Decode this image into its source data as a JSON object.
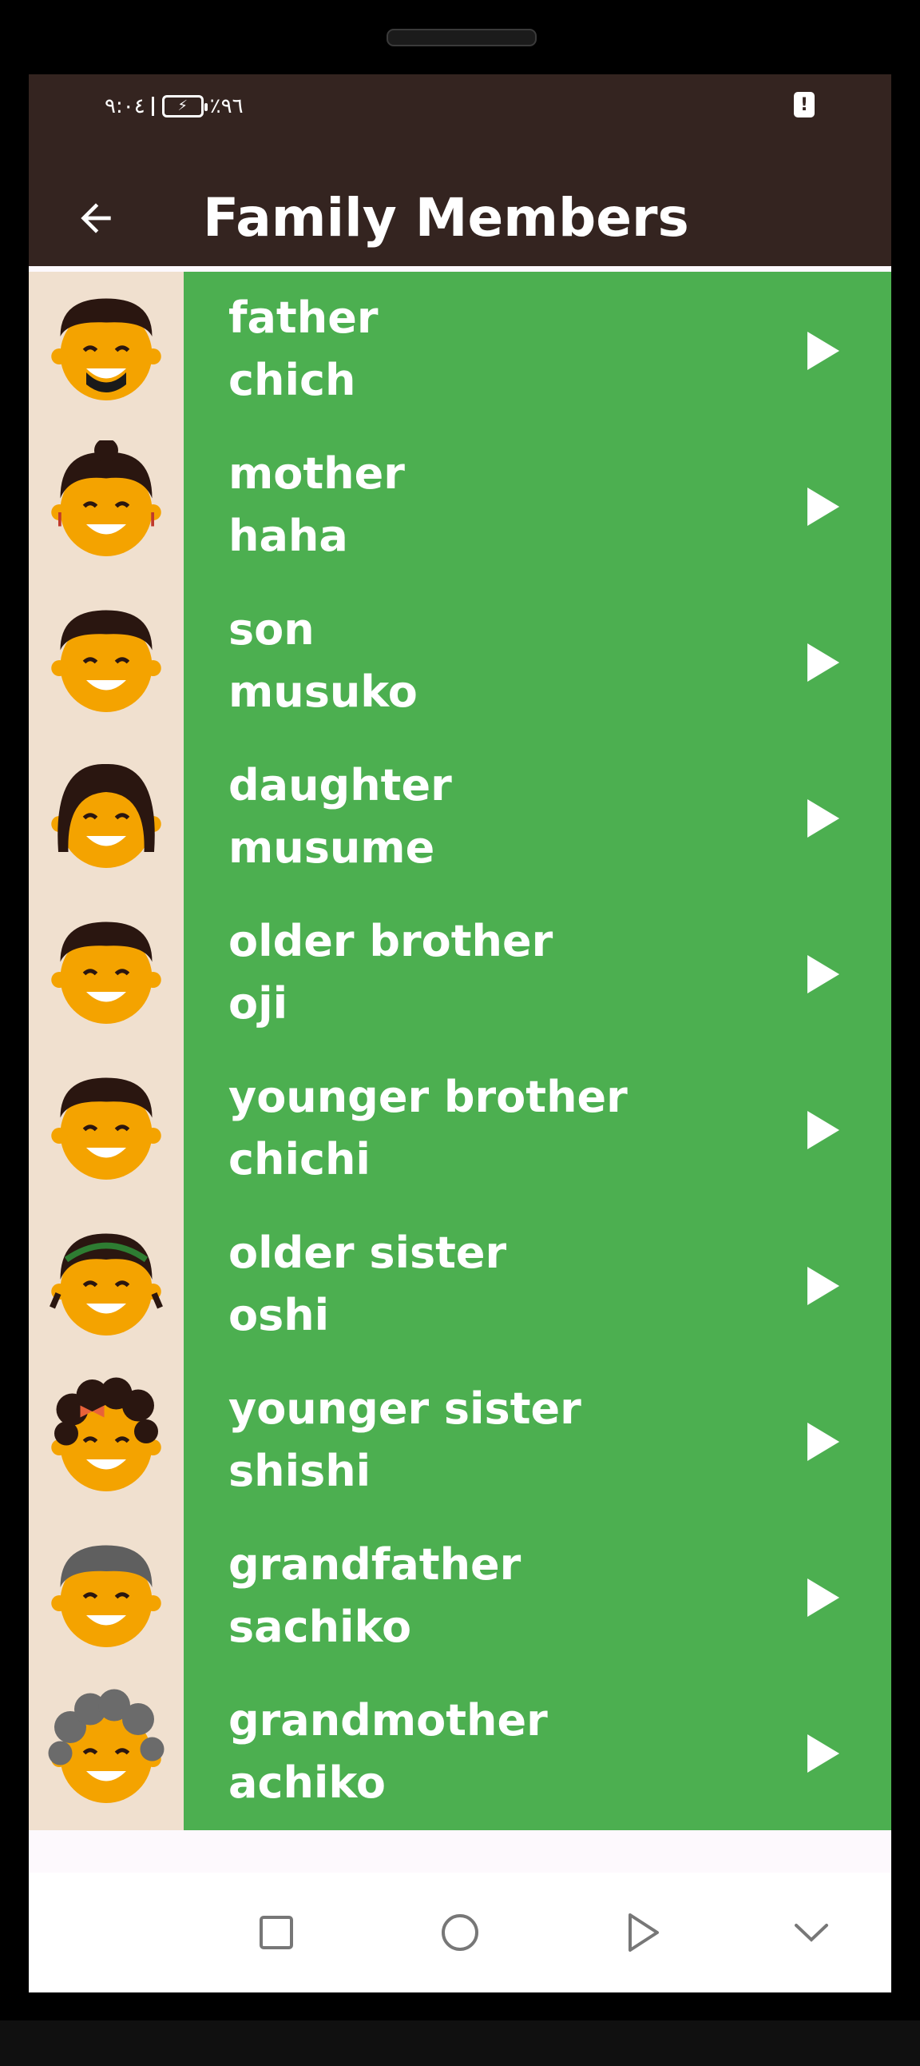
{
  "status_bar": {
    "time": "٩:٠٤",
    "battery_percent": "٪٩٦",
    "alert_icon_text": "!"
  },
  "app_bar": {
    "title": "Family Members"
  },
  "colors": {
    "app_bar_bg": "#342420",
    "row_bg": "#4caf50",
    "avatar_bg": "#f0e0cf",
    "face": "#f4a300"
  },
  "members": [
    {
      "word": "father",
      "translation": "chich",
      "icon": "father-face-icon"
    },
    {
      "word": "mother",
      "translation": "haha",
      "icon": "mother-face-icon"
    },
    {
      "word": "son",
      "translation": "musuko",
      "icon": "son-face-icon"
    },
    {
      "word": "daughter",
      "translation": "musume",
      "icon": "daughter-face-icon"
    },
    {
      "word": "older brother",
      "translation": "oji",
      "icon": "older-brother-face-icon"
    },
    {
      "word": "younger brother",
      "translation": "chichi",
      "icon": "younger-brother-face-icon"
    },
    {
      "word": "older sister",
      "translation": "oshi",
      "icon": "older-sister-face-icon"
    },
    {
      "word": "younger sister",
      "translation": "shishi",
      "icon": "younger-sister-face-icon"
    },
    {
      "word": "grandfather",
      "translation": "sachiko",
      "icon": "grandfather-face-icon"
    },
    {
      "word": "grandmother",
      "translation": "achiko",
      "icon": "grandmother-face-icon"
    }
  ],
  "nav_bar": {
    "buttons": [
      "recents-square-icon",
      "home-circle-icon",
      "back-triangle-icon",
      "hide-chevron-icon"
    ]
  }
}
